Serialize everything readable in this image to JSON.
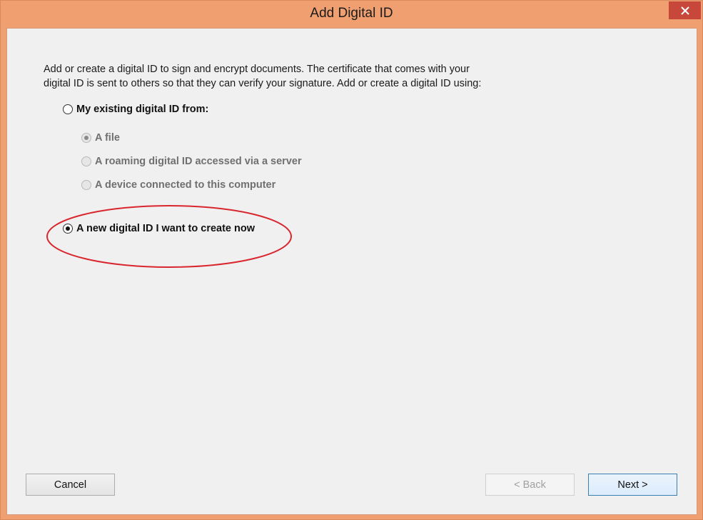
{
  "window": {
    "title": "Add Digital ID",
    "close_icon": "close-icon"
  },
  "description": {
    "line1": "Add or create a digital ID to sign and encrypt documents. The certificate that comes with your",
    "line2": "digital ID is sent to others so that they can verify your signature. Add or create a digital ID using:"
  },
  "options": {
    "existing": {
      "label": "My existing digital ID from:",
      "selected": false
    },
    "sub_options": [
      {
        "label": "A file",
        "selected": true,
        "enabled": false
      },
      {
        "label": "A roaming digital ID accessed via a server",
        "selected": false,
        "enabled": false
      },
      {
        "label": "A device connected to this computer",
        "selected": false,
        "enabled": false
      }
    ],
    "new_id": {
      "label": "A new digital ID I want to create now",
      "selected": true
    }
  },
  "annotation": {
    "color": "#d9262e",
    "shape": "ellipse"
  },
  "buttons": {
    "cancel": "Cancel",
    "back": "< Back",
    "next": "Next >"
  },
  "colors": {
    "frame": "#f0a070",
    "close_button": "#c7483b",
    "default_button_border": "#3c7fb1"
  }
}
